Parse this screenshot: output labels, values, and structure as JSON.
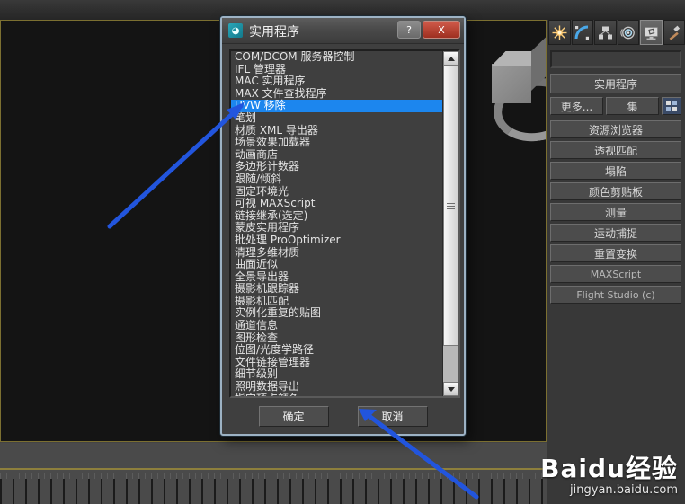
{
  "app": {
    "viewport_label": "",
    "panel_title": "实用程序"
  },
  "dialog": {
    "title": "实用程序",
    "icon": "utility-icon",
    "help_label": "?",
    "close_label": "X",
    "ok_label": "确定",
    "cancel_label": "取消",
    "selected_index": 4,
    "items": [
      "COM/DCOM 服务器控制",
      "IFL 管理器",
      "MAC 实用程序",
      "MAX 文件查找程序",
      "UVW 移除",
      "笔划",
      "材质 XML 导出器",
      "场景效果加载器",
      "动画商店",
      "多边形计数器",
      "跟随/倾斜",
      "固定环境光",
      "可视 MAXScript",
      "链接继承(选定)",
      "蒙皮实用程序",
      "批处理 ProOptimizer",
      "清理多维材质",
      "曲面近似",
      "全景导出器",
      "摄影机跟踪器",
      "摄影机匹配",
      "实例化重复的贴图",
      "通道信息",
      "图形检查",
      "位图/光度学路径",
      "文件链接管理器",
      "细节级别",
      "照明数据导出",
      "指定顶点颜色"
    ]
  },
  "panel": {
    "tabs": [
      {
        "name": "create-tab",
        "icon": "star-icon",
        "active": false
      },
      {
        "name": "modify-tab",
        "icon": "arc-icon",
        "active": false
      },
      {
        "name": "hierarchy-tab",
        "icon": "hierarchy-icon",
        "active": false
      },
      {
        "name": "motion-tab",
        "icon": "motion-icon",
        "active": false
      },
      {
        "name": "display-tab",
        "icon": "monitor-icon",
        "active": true
      },
      {
        "name": "utilities-tab",
        "icon": "hammer-icon",
        "active": false
      }
    ],
    "name_field_value": "",
    "rollout_title": "实用程序",
    "collapse_symbol": "-",
    "more_label": "更多...",
    "sets_label": "集",
    "buttons": [
      "资源浏览器",
      "透视匹配",
      "塌陷",
      "颜色剪贴板",
      "测量",
      "运动捕捉",
      "重置变换",
      "MAXScript",
      "Flight Studio (c)"
    ]
  },
  "watermark": {
    "main_prefix": "Bai",
    "main_mid": "du",
    "main_suffix": "经验",
    "sub": "jingyan.baidu.com"
  },
  "colors": {
    "selection_blue": "#1c86ee",
    "annotation_blue": "#2255dd",
    "viewport_border": "#7c7031",
    "close_red": "#c0392b"
  }
}
